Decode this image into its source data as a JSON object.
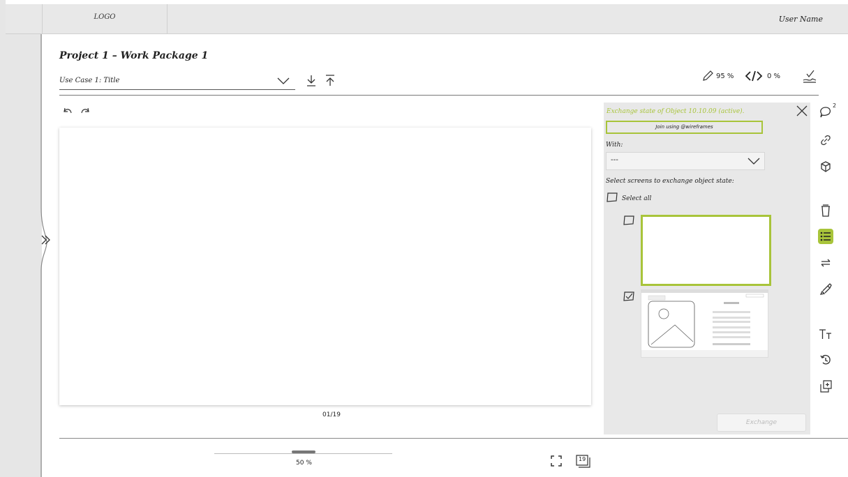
{
  "header": {
    "logo": "LOGO",
    "user_name": "User Name"
  },
  "project": {
    "title": "Project 1 – Work Package 1"
  },
  "use_case_select": {
    "value": "Use Case 1: Title"
  },
  "toolbar_stats": {
    "edit_percent": "95 %",
    "code_percent": "0 %"
  },
  "panel": {
    "title": "Exchange state of Object 10.10.09 (active).",
    "join_text": "Join using @wireframes",
    "with_label": "With:",
    "with_value": "---",
    "select_screens_label": "Select screens to exchange object state:",
    "select_all_label": "Select all",
    "exchange_button": "Exchange"
  },
  "comments_badge": "2",
  "page_indicator": "01/19",
  "zoom": {
    "label": "50 %",
    "level": 0.5
  },
  "page_count_icon": "19",
  "colors": {
    "accent": "#a8c43a",
    "panel_bg": "#e8e8e8",
    "chrome_bg": "#e6e6e6"
  }
}
